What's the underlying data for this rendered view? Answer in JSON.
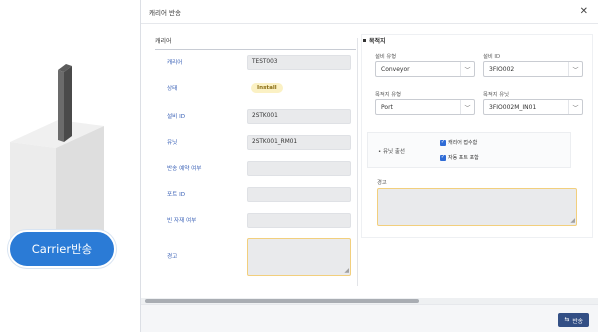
{
  "badge": {
    "label": "Carrier반송"
  },
  "dialog": {
    "title": "캐리어 반송",
    "close_icon": "close-icon",
    "left": {
      "section_title": "캐리어",
      "fields": [
        {
          "label": "캐리어",
          "value": "TEST003"
        },
        {
          "label": "상태",
          "value": "Install"
        },
        {
          "label": "설비 ID",
          "value": "2STK001"
        },
        {
          "label": "유닛",
          "value": "2STK001_RM01"
        },
        {
          "label": "반송 예약 여부",
          "value": ""
        },
        {
          "label": "포트 ID",
          "value": ""
        },
        {
          "label": "빈 자재 여부",
          "value": ""
        },
        {
          "label": "경고",
          "value": ""
        }
      ]
    },
    "right": {
      "section_title": "목적지",
      "equip_type_label": "설비 유형",
      "equip_type_value": "Conveyor",
      "equip_id_label": "설비 ID",
      "equip_id_value": "3FIO002",
      "dest_type_label": "목적지 유형",
      "dest_type_value": "Port",
      "dest_unit_label": "목적지 유닛",
      "dest_unit_value": "3FIO002M_IN01",
      "unit_option_label": "유닛 출선",
      "checkbox1_label": "캐리어 접수함",
      "checkbox2_label": "자동 포트 포함",
      "warn_label": "경고"
    },
    "footer": {
      "submit_label": "반송"
    }
  }
}
